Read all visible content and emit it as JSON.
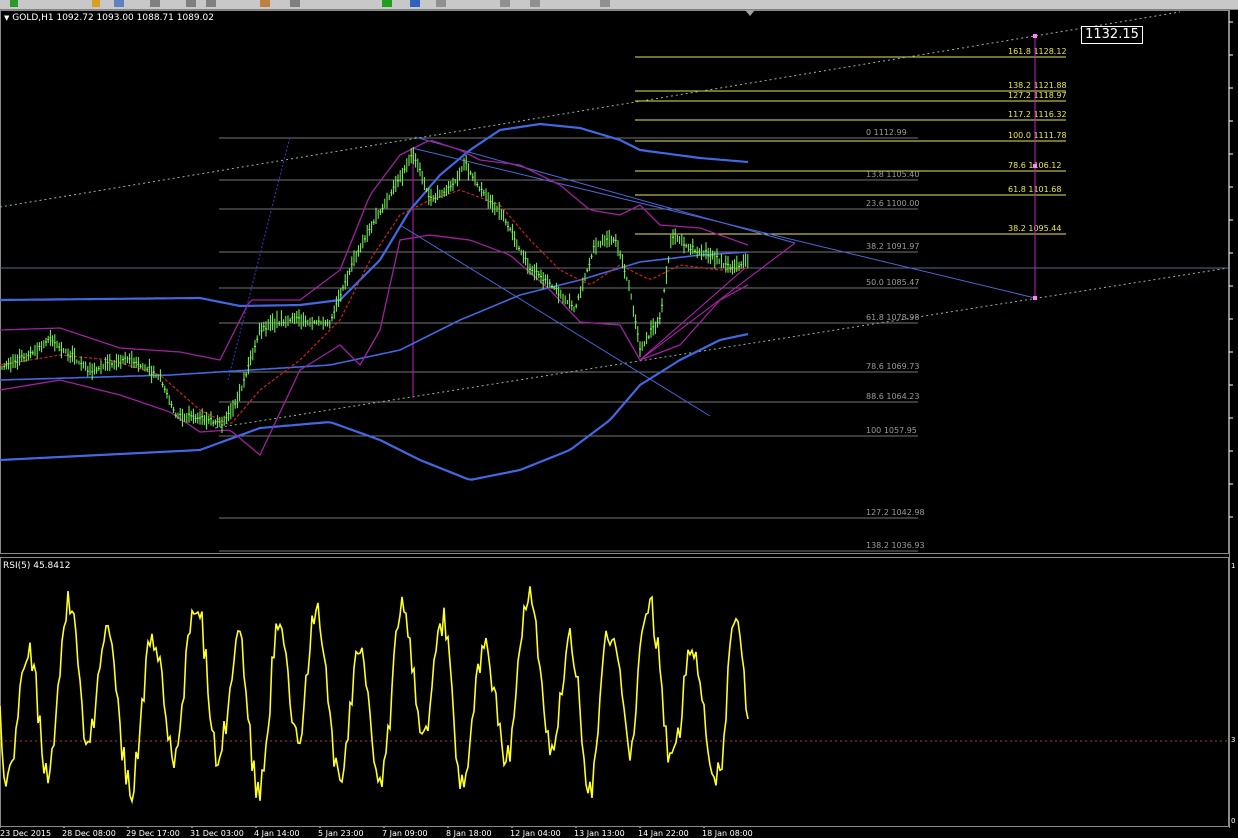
{
  "header": {
    "symbol_line": "GOLD,H1  1092.72 1093.00 1088.71 1089.02",
    "rsi_line": "RSI(5) 45.8412"
  },
  "price_tag": "1132.15",
  "fib_right": [
    {
      "level": "161.8",
      "price": "1128.12"
    },
    {
      "level": "138.2",
      "price": "1121.88"
    },
    {
      "level": "127.2",
      "price": "1118.97"
    },
    {
      "level": "117.2",
      "price": "1116.32"
    },
    {
      "level": "100.0",
      "price": "1111.78"
    },
    {
      "level": "78.6",
      "price": "1106.12"
    },
    {
      "level": "61.8",
      "price": "1101.68"
    },
    {
      "level": "38.2",
      "price": "1095.44"
    }
  ],
  "fib_left": [
    {
      "level": "0",
      "price": "1112.99"
    },
    {
      "level": "13.8",
      "price": "1105.40"
    },
    {
      "level": "23.6",
      "price": "1100.00"
    },
    {
      "level": "38.2",
      "price": "1091.97"
    },
    {
      "level": "50.0",
      "price": "1085.47"
    },
    {
      "level": "61.8",
      "price": "1078.98"
    },
    {
      "level": "78.6",
      "price": "1069.73"
    },
    {
      "level": "88.6",
      "price": "1064.23"
    },
    {
      "level": "100",
      "price": "1057.95"
    },
    {
      "level": "127.2",
      "price": "1042.98"
    },
    {
      "level": "138.2",
      "price": "1036.93"
    }
  ],
  "time_labels": [
    "23 Dec 2015",
    "28 Dec 08:00",
    "29 Dec 17:00",
    "31 Dec 03:00",
    "4 Jan 14:00",
    "5 Jan 23:00",
    "7 Jan 09:00",
    "8 Jan 18:00",
    "12 Jan 04:00",
    "13 Jan 13:00",
    "14 Jan 22:00",
    "18 Jan 08:00"
  ],
  "rsi_scale": {
    "top": "1",
    "mid": "3",
    "bottom": "0"
  },
  "colors": {
    "candles": "#7cfc5a",
    "bollinger": "#4169e1",
    "envelope": "#a020a0",
    "trend": "#4c66d8",
    "fib_right": "#e8e850",
    "fib_left": "#9a9a9a",
    "rsi": "#ffff20",
    "channel": "#8fbc8f",
    "measure": "#c020c0"
  }
}
